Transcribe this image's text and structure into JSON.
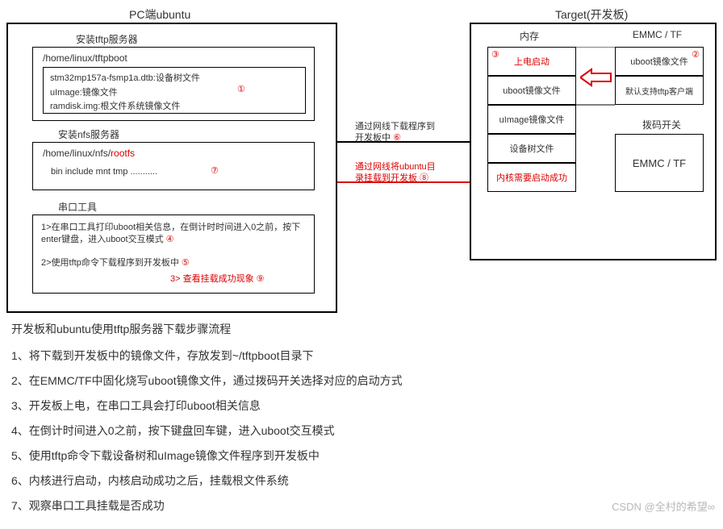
{
  "titles": {
    "pc": "PC端ubuntu",
    "target": "Target(开发板)"
  },
  "pc": {
    "tftp_label": "安装tftp服务器",
    "tftp_path": "/home/linux/tftpboot",
    "tftp_l1": "stm32mp157a-fsmp1a.dtb:设备树文件",
    "tftp_l2": "uImage:镜像文件",
    "tftp_l3": "ramdisk.img:根文件系统镜像文件",
    "tftp_badge": "①",
    "nfs_label": "安装nfs服务器",
    "nfs_path_a": "/home/linux/nfs/",
    "nfs_path_b": "rootfs",
    "nfs_l1": "bin include mnt tmp ...........",
    "nfs_badge": "⑦",
    "serial_label": "串口工具",
    "serial_l1": "1>在串口工具打印uboot相关信息，在倒计时时间进入0之前，按下enter键盘，进入uboot交互模式",
    "serial_b1": "④",
    "serial_l2": "2>使用tftp命令下载程序到开发板中",
    "serial_b2": "⑤",
    "serial_l3": "3> 查看挂载成功现象",
    "serial_b3": "⑨"
  },
  "conn": {
    "down_a": "通过网线下载程序到",
    "down_b": "开发板中",
    "down_badge": "⑥",
    "mount_a": "通过网线将ubuntu目",
    "mount_b": "录挂载到开发板",
    "mount_badge": "⑧"
  },
  "target": {
    "mem_label": "内存",
    "emmc_label": "EMMC / TF",
    "mem_row1": "上电启动",
    "mem_row1_badge": "③",
    "mem_row2": "uboot镜像文件",
    "mem_row3": "uImage镜像文件",
    "mem_row4": "设备树文件",
    "mem_row5": "内核需要启动成功",
    "emmc_row1": "uboot镜像文件",
    "emmc_row1_badge": "②",
    "emmc_row2": "默认支持tftp客户端",
    "dip_label": "拨码开关",
    "dip_box": "EMMC /  TF"
  },
  "steps": {
    "title": "开发板和ubuntu使用tftp服务器下载步骤流程",
    "s1": "1、将下载到开发板中的镜像文件，存放发到~/tftpboot目录下",
    "s2": "2、在EMMC/TF中固化烧写uboot镜像文件，通过拨码开关选择对应的启动方式",
    "s3": "3、开发板上电，在串口工具会打印uboot相关信息",
    "s4": "4、在倒计时间进入0之前，按下键盘回车键，进入uboot交互模式",
    "s5": "5、使用tftp命令下载设备树和uImage镜像文件程序到开发板中",
    "s6": "6、内核进行启动，内核启动成功之后，挂载根文件系统",
    "s7": "7、观察串口工具挂载是否成功"
  },
  "watermark": "CSDN @全村的希望∞"
}
